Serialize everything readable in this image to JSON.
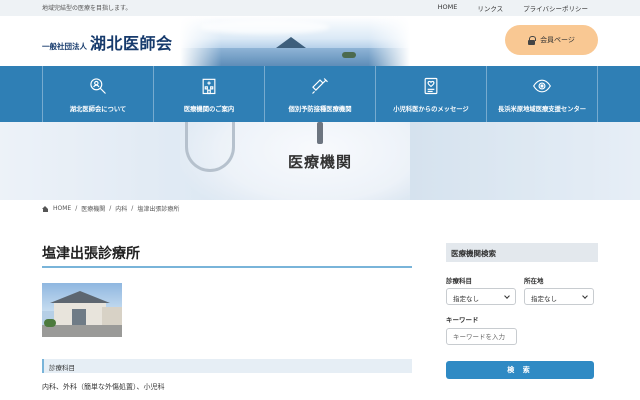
{
  "topbar": {
    "tagline": "地域完結型の医療を目指します。",
    "links": [
      "HOME",
      "リンクス",
      "プライバシーポリシー"
    ]
  },
  "header": {
    "logo_small": "一般社団法人",
    "logo_big": "湖北医師会",
    "member_button": "会員ページ"
  },
  "nav": {
    "items": [
      {
        "label": "湖北医師会について",
        "icon": "magnifier-person-icon"
      },
      {
        "label": "医療機関のご案内",
        "icon": "hospital-building-icon"
      },
      {
        "label": "個別予防接種医療機関",
        "icon": "syringe-icon"
      },
      {
        "label": "小児科医からのメッセージ",
        "icon": "heart-document-icon"
      },
      {
        "label": "長浜米原地域医療支援センター",
        "icon": "eye-icon"
      }
    ]
  },
  "hero": {
    "title": "医療機関"
  },
  "breadcrumb": {
    "items": [
      "HOME",
      "医療機関",
      "内科",
      "塩津出張診療所"
    ],
    "separator": "/"
  },
  "main": {
    "title": "塩津出張診療所",
    "section_heading": "診療科目",
    "section_body": "内科、外科（簡単な外傷処置）、小児科"
  },
  "sidebar": {
    "heading": "医療機関検索",
    "department_label": "診療科目",
    "department_value": "指定なし",
    "location_label": "所在地",
    "location_value": "指定なし",
    "keyword_label": "キーワード",
    "keyword_placeholder": "キーワードを入力",
    "search_button": "検 索"
  },
  "colors": {
    "nav_bg": "#2f7fb5",
    "member_button_bg": "#f9c893",
    "accent_rule": "#79b4d9",
    "search_button_bg": "#2f8ac4"
  }
}
